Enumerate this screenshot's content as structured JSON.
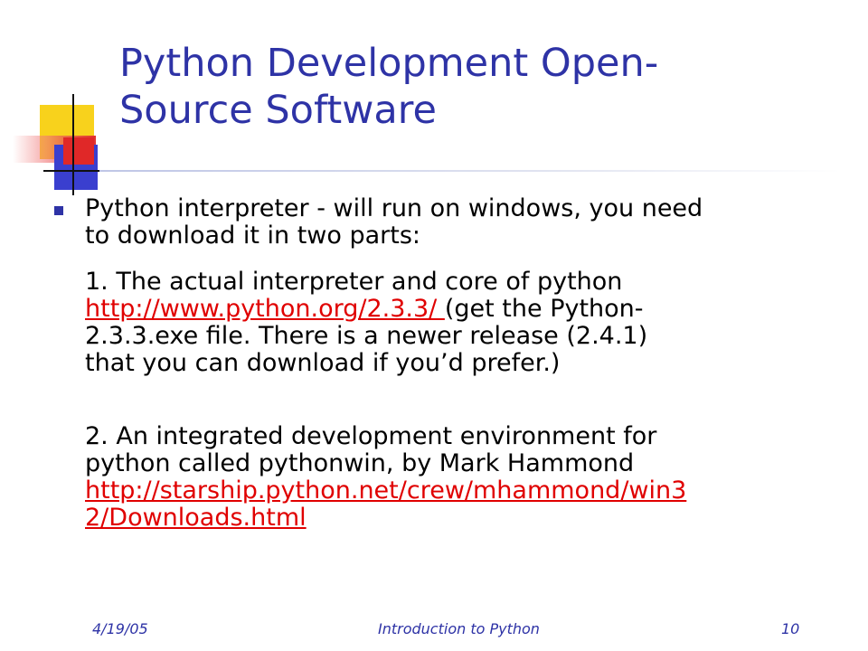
{
  "title": {
    "line1": "Python Development Open-",
    "line2": "Source Software"
  },
  "bullet": {
    "line1": "Python interpreter - will run on windows, you need",
    "line2": "to download it in two parts:"
  },
  "part1": {
    "line1": "1. The actual interpreter and core of python",
    "link": "http://www.python.org/2.3.3/ ",
    "line2_rest": "(get the Python-",
    "line3": "2.3.3.exe file.  There is a newer release (2.4.1)",
    "line4": "that you can download if you’d prefer.)"
  },
  "part2": {
    "line1": "2. An integrated development environment for",
    "line2": "python called pythonwin, by Mark Hammond",
    "link_line1": "http://starship.python.net/crew/mhammond/win3",
    "link_line2": "2/Downloads.html"
  },
  "footer": {
    "date": "4/19/05",
    "title": "Introduction to Python",
    "page": "10"
  },
  "colors": {
    "title": "#2e33a6",
    "link": "#e00000",
    "accent_yellow": "#f8d21c",
    "accent_blue": "#3a3fcf",
    "accent_red": "#e02828"
  }
}
